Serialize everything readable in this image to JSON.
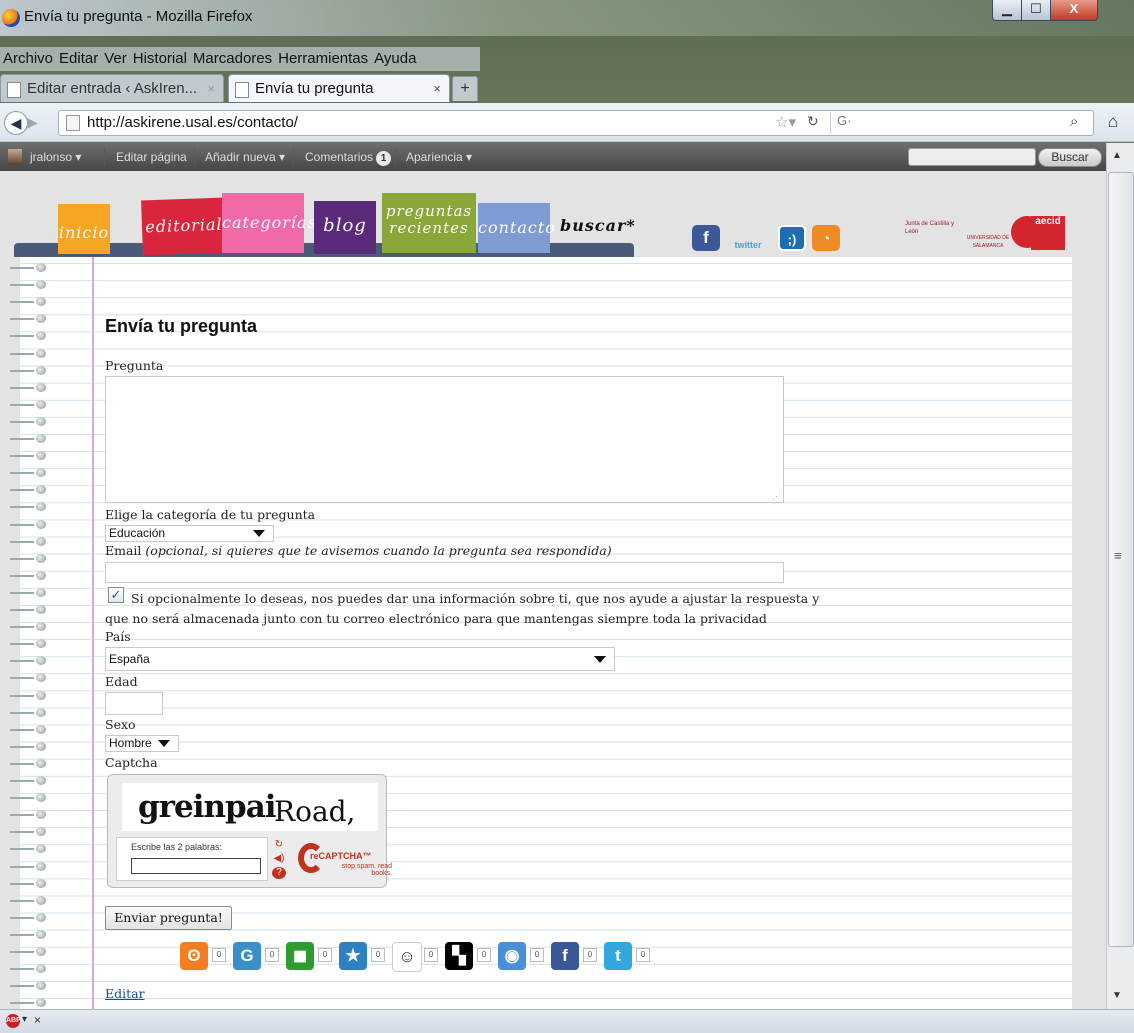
{
  "window": {
    "title": "Envía tu pregunta - Mozilla Firefox",
    "min": "▁",
    "max": "☐",
    "close": "X"
  },
  "menubar": [
    "Archivo",
    "Editar",
    "Ver",
    "Historial",
    "Marcadores",
    "Herramientas",
    "Ayuda"
  ],
  "tabs": [
    {
      "label": "Editar entrada ‹ AskIren...",
      "close": "×"
    },
    {
      "label": "Envía tu pregunta",
      "close": "×"
    }
  ],
  "new_tab": "+",
  "navbar": {
    "url": "http://askirene.usal.es/contacto/",
    "search_engine": "G·"
  },
  "adminbar": {
    "user": "jralonso ▾",
    "edit_page": "Editar página",
    "add_new": "Añadir nueva ▾",
    "comments": "Comentarios",
    "comments_count": "1",
    "appearance": "Apariencia ▾",
    "search_button": "Buscar"
  },
  "site_nav": [
    {
      "label": "inicio",
      "color": "#f5a623"
    },
    {
      "label": "editorial",
      "color": "#d9263c"
    },
    {
      "label": "categorías",
      "color": "#f06aa8"
    },
    {
      "label": "blog",
      "color": "#5b2a7a"
    },
    {
      "label": "preguntas recientes",
      "color": "#8aa83a"
    },
    {
      "label": "contacto",
      "color": "#7f9bd4"
    },
    {
      "label": "buscar",
      "color": "#222222"
    }
  ],
  "social": {
    "facebook": "f",
    "twitter": "twitter",
    "tuenti": ";)",
    "rss": "rss"
  },
  "sponsors": [
    "Junta de Castilla y León",
    "UNIVERSIDAD DE SALAMANCA",
    "aecid"
  ],
  "form": {
    "title": "Envía tu pregunta",
    "question_label": "Pregunta",
    "question_value": "",
    "category_label": "Elige la categoría de tu pregunta",
    "category_value": "Educación",
    "email_label": "Email",
    "email_hint": "(opcional, si quieres que te avisemos cuando la pregunta sea respondida)",
    "email_value": "",
    "optin_checked": true,
    "optin_text_1": "Si opcionalmente lo deseas, nos puedes dar una información sobre ti, que nos ayude a ajustar la respuesta y",
    "optin_text_2": "que no será almacenada junto con tu correo electrónico para que mantengas siempre toda la privacidad",
    "country_label": "País",
    "country_value": "España",
    "age_label": "Edad",
    "age_value": "",
    "sex_label": "Sexo",
    "sex_value": "Hombre",
    "captcha_label": "Captcha",
    "captcha_word_1": "greinpai",
    "captcha_word_2": "Road,",
    "captcha_hint": "Escribe las 2 palabras:",
    "captcha_brand": "reCAPTCHA™",
    "captcha_slogan": "stop spam. read books.",
    "submit_label": "Enviar pregunta!",
    "edit_link": "Editar"
  },
  "share_buttons": [
    {
      "name": "meneame",
      "color": "#f57c1f",
      "count": "0"
    },
    {
      "name": "google",
      "color": "#3b8fc9",
      "count": "0"
    },
    {
      "name": "digg",
      "color": "#2d9b2d",
      "count": "0"
    },
    {
      "name": "bookmark",
      "color": "#2f80c2",
      "count": "0"
    },
    {
      "name": "reddit",
      "color": "#ffffff",
      "count": "0"
    },
    {
      "name": "delicious",
      "color": "#000000",
      "count": "0"
    },
    {
      "name": "buzz",
      "color": "#4a90d9",
      "count": "0"
    },
    {
      "name": "facebook",
      "color": "#3b5998",
      "count": "0"
    },
    {
      "name": "twitter",
      "color": "#33a6dd",
      "count": "0"
    }
  ],
  "statusbar": {
    "close": "×",
    "abp": "ABP"
  }
}
